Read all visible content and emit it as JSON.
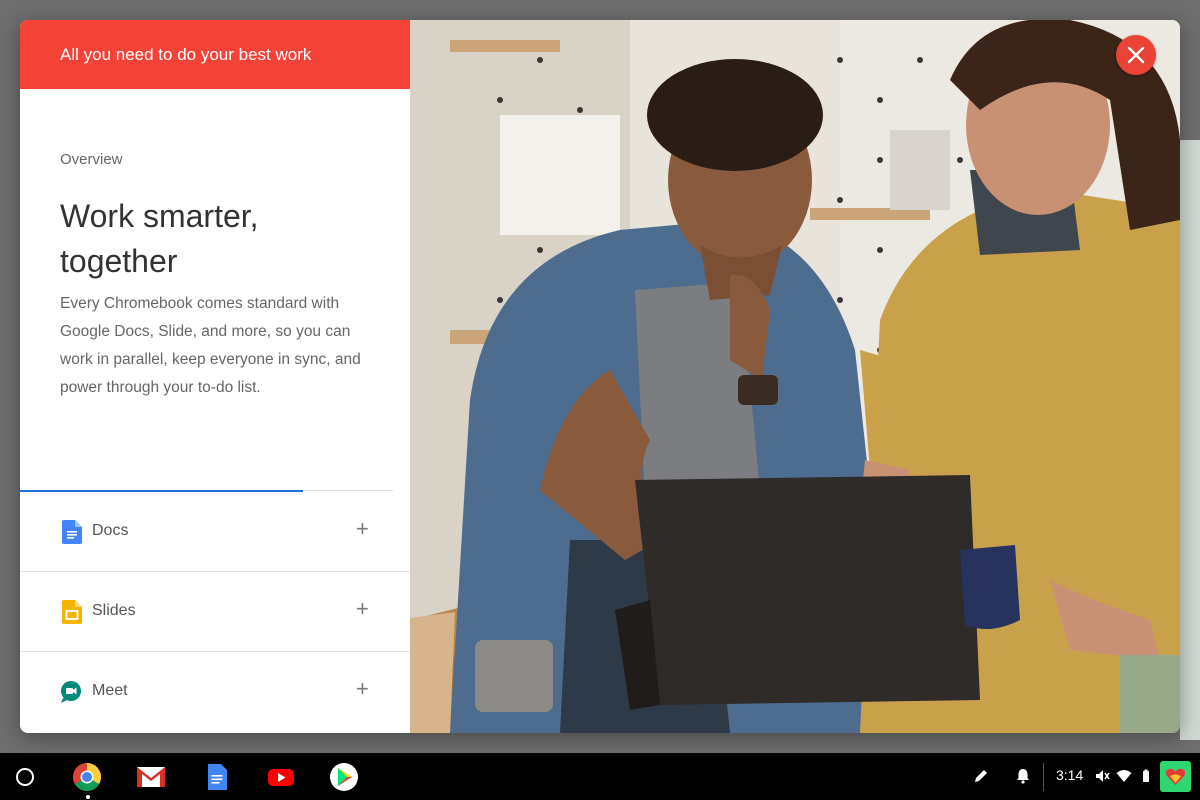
{
  "dialog": {
    "header_title": "All you need to do your best work",
    "section_label": "Overview",
    "headline": "Work smarter, together",
    "body": "Every Chromebook comes standard with Google Docs, Slide, and more, so you can work in parallel, keep everyone in sync, and power through your to-do list.",
    "accent_color": "#f44336",
    "progress": 0.76,
    "items": [
      {
        "label": "Docs",
        "icon": "docs-icon",
        "expand": "+"
      },
      {
        "label": "Slides",
        "icon": "slides-icon",
        "expand": "+"
      },
      {
        "label": "Meet",
        "icon": "meet-icon",
        "expand": "+"
      }
    ],
    "close_icon": "close-icon"
  },
  "shelf": {
    "apps": [
      "launcher-icon",
      "chrome-icon",
      "gmail-icon",
      "docs-icon",
      "youtube-icon",
      "play-store-icon"
    ],
    "time": "3:14",
    "tray_icons": [
      "stylus-icon",
      "notification-bell-icon",
      "mute-icon",
      "wifi-icon",
      "battery-icon",
      "keep-app-icon"
    ]
  }
}
